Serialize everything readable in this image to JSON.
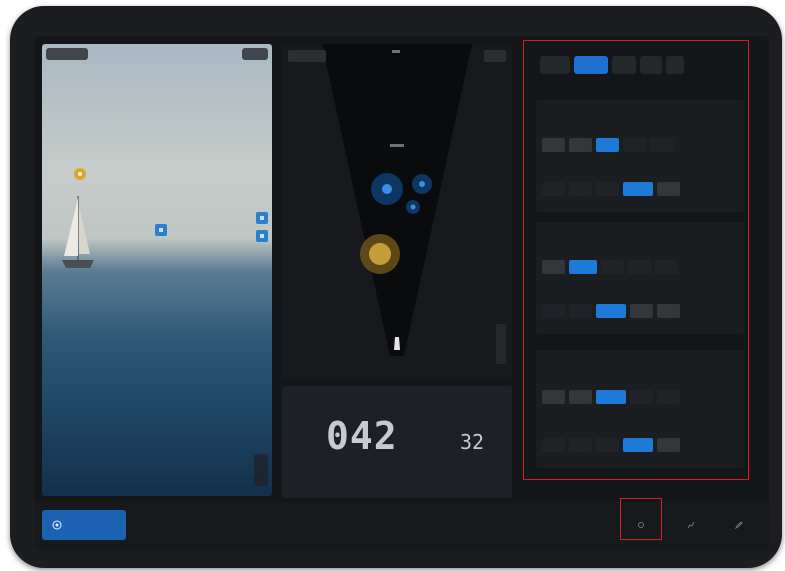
{
  "camera": {
    "top_left_chip": "",
    "top_right_chip": ""
  },
  "settings": {
    "tabs": [
      "",
      "",
      "",
      "",
      ""
    ],
    "sections": [
      {
        "title": "",
        "row1_label": "",
        "row1_options": [
          "",
          "",
          ""
        ],
        "row2_label": "",
        "row2_options": [
          "",
          ""
        ]
      },
      {
        "title": "",
        "row1_label": "",
        "row1_options": [
          "",
          ""
        ],
        "row2_label": "",
        "row2_options": [
          "",
          "",
          ""
        ]
      },
      {
        "title": "",
        "row1_label": "",
        "row1_options": [
          "",
          "",
          ""
        ],
        "row2_label": "",
        "row2_options": [
          "",
          ""
        ]
      }
    ]
  },
  "readout": {
    "left_label": "",
    "right_label": "",
    "heading": "042",
    "speed": "32"
  },
  "bottombar": {
    "primary_label": "",
    "link1": "",
    "link2": "",
    "icon_buttons": [
      "",
      "",
      ""
    ]
  },
  "icons": {
    "primary_button": "target-icon",
    "bottom": [
      "settings-icon",
      "chart-icon",
      "edit-icon"
    ]
  },
  "colors": {
    "accent": "#1e7ad8",
    "highlight": "#d32020",
    "target_yellow": "#d9a730"
  }
}
